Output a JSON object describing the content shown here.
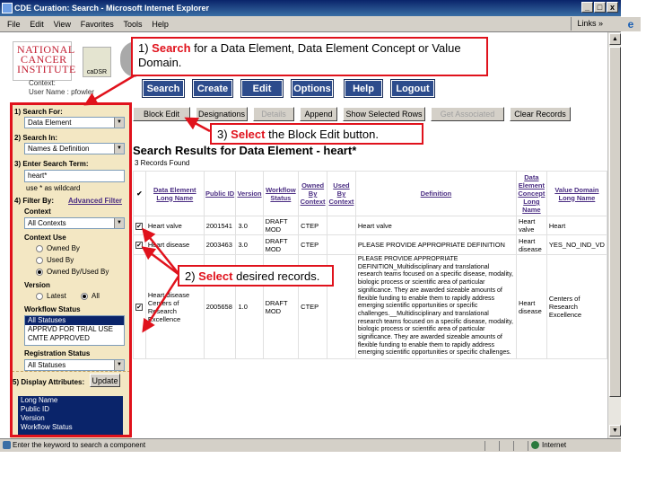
{
  "window": {
    "title": "CDE Curation: Search - Microsoft Internet Explorer",
    "min": "_",
    "max": "□",
    "close": "x"
  },
  "menu": [
    "File",
    "Edit",
    "View",
    "Favorites",
    "Tools",
    "Help"
  ],
  "links_label": "Links",
  "links_chevron": "»",
  "status_text": "Enter the keyword to search a component",
  "zone": "Internet",
  "header": {
    "logo_lines": [
      "NATIONAL",
      "CANCER",
      "INSTITUTE"
    ],
    "cadsr": "caDSR",
    "context_label": "Context:",
    "username": "User Name : pfowler"
  },
  "nav": [
    "Search",
    "Create",
    "Edit",
    "Options",
    "Help",
    "Logout"
  ],
  "left": {
    "search_for_label": "1) Search For:",
    "search_for_value": "Data Element",
    "search_in_label": "2) Search In:",
    "search_in_value": "Names & Definition",
    "term_label": "3) Enter Search Term:",
    "term_value": "heart*",
    "wildcard_hint": "use * as wildcard",
    "filter_label": "4) Filter By:",
    "advanced_filter": "Advanced Filter",
    "context_label": "Context",
    "context_value": "All Contexts",
    "context_use_label": "Context Use",
    "owned_by": "Owned By",
    "used_by": "Used By",
    "owned_used_by": "Owned By/Used By",
    "version_label": "Version",
    "latest": "Latest",
    "all": "All",
    "workflow_label": "Workflow Status",
    "workflow_items": [
      "All Statuses",
      "APPRVD FOR TRIAL USE",
      "CMTE APPROVED"
    ],
    "registration_label": "Registration Status",
    "registration_value": "All Statuses",
    "display_attrs_label": "5) Display Attributes:",
    "update_button": "Update",
    "attr_items": [
      "Long Name",
      "Public ID",
      "Version",
      "Workflow Status"
    ]
  },
  "toolbar": [
    "Block Edit",
    "Designations",
    "Details",
    "Append",
    "Show Selected Rows",
    "Get Associated",
    "Clear Records"
  ],
  "results": {
    "title": "Search Results for Data Element - heart*",
    "count": "3 Records Found",
    "check_header": "✔",
    "columns": [
      "Data Element Long Name",
      "Public ID",
      "Version",
      "Workflow Status",
      "Owned By Context",
      "Used By Context",
      "Definition",
      "Data Element Concept Long Name",
      "Value Domain Long Name"
    ],
    "rows": [
      {
        "checked": "✔",
        "name": "Heart valve",
        "id": "2001541",
        "version": "3.0",
        "status": "DRAFT MOD",
        "owned": "CTEP",
        "used": "",
        "definition": "Heart valve",
        "dec": "Heart valve",
        "vd": "Heart"
      },
      {
        "checked": "✔",
        "name": "Heart disease",
        "id": "2003463",
        "version": "3.0",
        "status": "DRAFT MOD",
        "owned": "CTEP",
        "used": "",
        "definition": "PLEASE PROVIDE APPROPRIATE DEFINITION",
        "dec": "Heart disease",
        "vd": "YES_NO_IND_VD"
      },
      {
        "checked": "✔",
        "name": "Heart disease Centers of Research Excellence",
        "id": "2005658",
        "version": "1.0",
        "status": "DRAFT MOD",
        "owned": "CTEP",
        "used": "",
        "definition": "PLEASE PROVIDE APPROPRIATE DEFINITION_Multidisciplinary and translational research teams focused on a specific disease, modality, biologic process or scientific area of particular significance. They are awarded sizeable amounts of flexible funding to enable them to rapidly address emerging scientific opportunities or specific challenges.__Multidisciplinary and translational research teams focused on a specific disease, modality, biologic process or scientific area of particular significance. They are awarded sizeable amounts of flexible funding to enable them to rapidly address emerging scientific opportunities or specific challenges.",
        "dec": "Heart disease",
        "vd": "Centers of Research Excellence"
      }
    ]
  },
  "callouts": {
    "c1_strong": "Search",
    "c1_rest": " for a Data Element, Data Element Concept or Value Domain.",
    "c1_num": "1) ",
    "c2_num": "2) ",
    "c2_strong": "Select",
    "c2_rest": " desired records.",
    "c3_num": "3) ",
    "c3_strong": "Select",
    "c3_rest": " the Block Edit button."
  },
  "colors": {
    "accent_red": "#e0121c",
    "nav_blue": "#2d4c8c",
    "panel_tan": "#f3e7c3",
    "link_purple": "#4b2e83"
  }
}
